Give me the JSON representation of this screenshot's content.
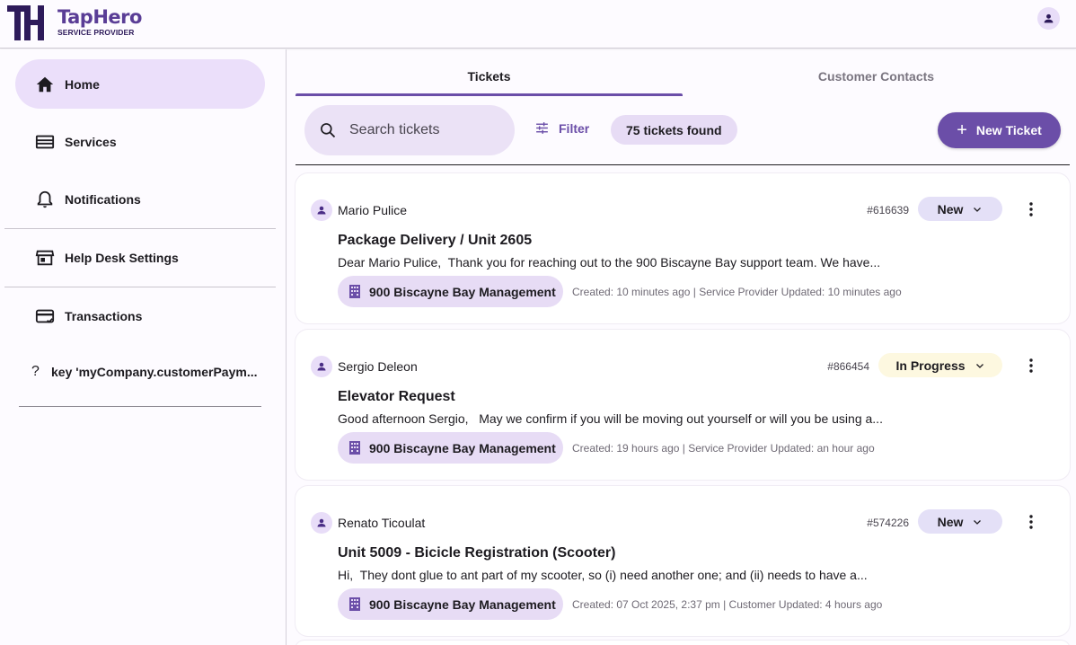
{
  "brand": {
    "name": "TapHero",
    "subtitle": "SERVICE PROVIDER",
    "primary_color": "#6b4ea8",
    "chip_color": "#e7dcf5"
  },
  "sidebar": {
    "items": [
      {
        "label": "Home",
        "icon": "home-icon",
        "active": true
      },
      {
        "label": "Services",
        "icon": "services-icon"
      },
      {
        "label": "Notifications",
        "icon": "bell-icon"
      },
      {
        "label": "Help Desk Settings",
        "icon": "storefront-icon"
      },
      {
        "label": "Transactions",
        "icon": "credit-card-icon"
      }
    ],
    "key_item": {
      "icon_text": "?",
      "label": "key 'myCompany.customerPaym..."
    }
  },
  "tabs": [
    {
      "label": "Tickets",
      "active": true
    },
    {
      "label": "Customer Contacts",
      "active": false
    }
  ],
  "toolbar": {
    "search_placeholder": "Search tickets",
    "filter_label": "Filter",
    "count_label": "75 tickets found",
    "new_ticket_label": "New Ticket"
  },
  "tickets": [
    {
      "requester": "Mario Pulice",
      "id": "#616639",
      "status": "New",
      "title": "Package Delivery / Unit 2605",
      "preview": "Dear Mario Pulice,  Thank you for reaching out to the 900 Biscayne Bay support team. We have...",
      "property": "900 Biscayne Bay Management",
      "meta": "Created: 10 minutes ago | Service Provider Updated: 10 minutes ago"
    },
    {
      "requester": "Sergio Deleon",
      "id": "#866454",
      "status": "In Progress",
      "title": "Elevator Request",
      "preview": "Good afternoon Sergio,   May we confirm if you will be moving out yourself or will you be using a...",
      "property": "900 Biscayne Bay Management",
      "meta": "Created: 19 hours ago | Service Provider Updated: an hour ago"
    },
    {
      "requester": "Renato Ticoulat",
      "id": "#574226",
      "status": "New",
      "title": "Unit 5009 - Bicicle Registration (Scooter)",
      "preview": "Hi,  They dont glue to ant part of my scooter, so (i) need another one; and (ii) needs to have a...",
      "property": "900 Biscayne Bay Management",
      "meta": "Created: 07 Oct 2025, 2:37 pm | Customer Updated: 4 hours ago"
    }
  ]
}
